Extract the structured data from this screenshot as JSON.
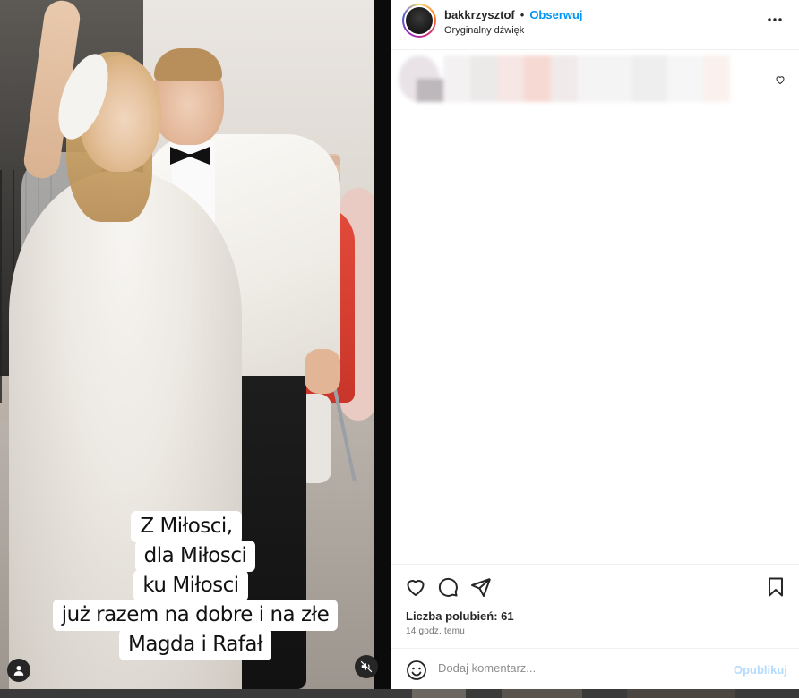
{
  "post": {
    "caption_lines": [
      "Z Miłosci,",
      "dla  Miłosci",
      "ku Miłosci",
      "już razem na dobre i na złe",
      "Magda i Rafał"
    ]
  },
  "header": {
    "username": "bakkrzysztof",
    "separator": "•",
    "follow_label": "Obserwuj",
    "audio_label": "Oryginalny dźwięk",
    "more_label": "•••"
  },
  "stats": {
    "likes_text": "Liczba polubień: 61",
    "time_text": "14 godz. temu"
  },
  "comment": {
    "placeholder": "Dodaj komentarz...",
    "publish_label": "Opublikuj"
  },
  "icons": {
    "like": "heart-icon",
    "comment": "comment-icon",
    "share": "share-icon",
    "save": "bookmark-icon",
    "emoji": "emoji-icon",
    "more": "more-icon",
    "tagged_user": "user-icon",
    "mute": "mute-icon"
  },
  "colors": {
    "follow": "#0095f6",
    "publish_disabled": "#b3dbff",
    "text": "#262626",
    "muted": "#737373"
  }
}
